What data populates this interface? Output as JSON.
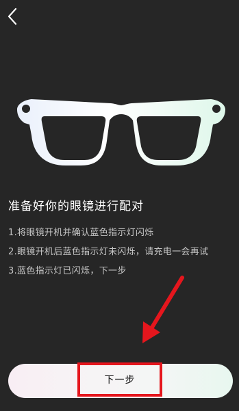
{
  "header": {
    "back_icon": "chevron-left-icon"
  },
  "illustration": {
    "icon": "glasses-icon"
  },
  "content": {
    "title": "准备好你的眼镜进行配对",
    "steps": [
      "1.将眼镜开机并确认蓝色指示灯闪烁",
      "2.眼镜开机后蓝色指示灯未闪烁，请充电一会再试",
      "3.蓝色指示灯已闪烁，下一步"
    ]
  },
  "annotation": {
    "arrow_icon": "red-arrow-icon",
    "color": "#e5161d"
  },
  "footer": {
    "next_label": "下一步"
  },
  "colors": {
    "background": "#262626",
    "title": "#ffffff",
    "step_text": "#c6c6c6",
    "highlight": "#e5161d"
  }
}
